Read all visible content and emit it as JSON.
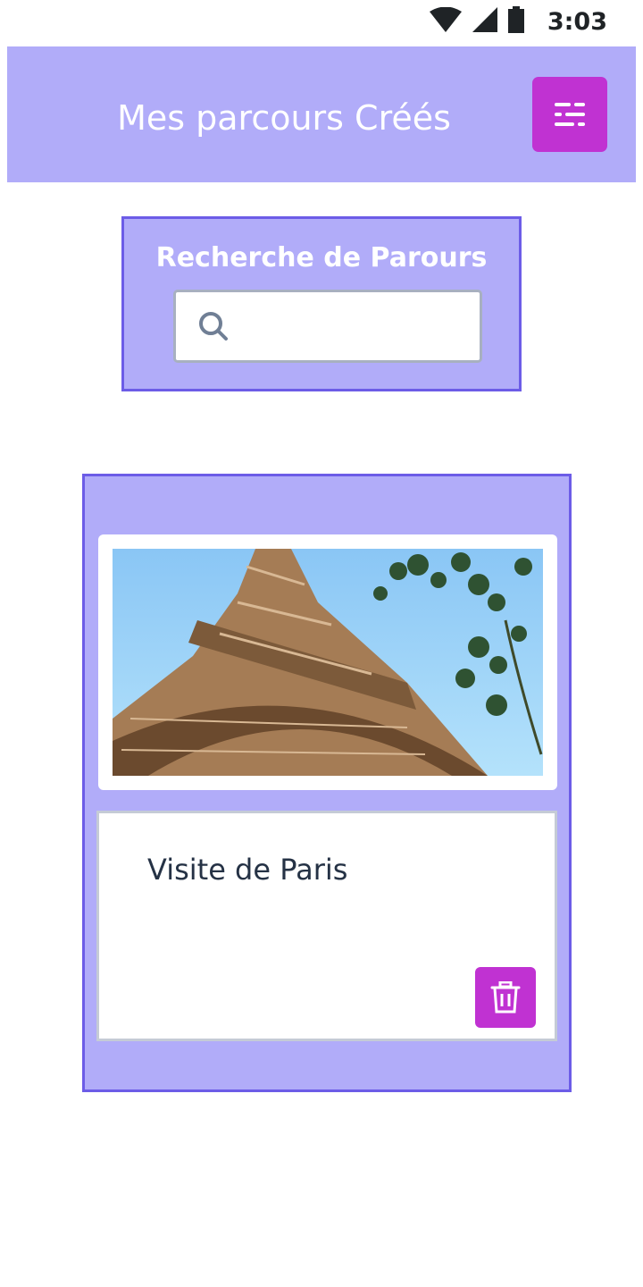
{
  "status_bar": {
    "time": "3:03",
    "icons": [
      "wifi-icon",
      "cell-signal-icon",
      "battery-icon"
    ]
  },
  "header": {
    "title": "Mes parcours Créés",
    "filter_icon": "filter-icon"
  },
  "search": {
    "title": "Recherche de Parours",
    "value": "",
    "icon": "search-icon"
  },
  "routes": [
    {
      "name": "Visite de Paris",
      "image": "eiffel-tower-photo",
      "delete_icon": "trash-icon"
    }
  ],
  "colors": {
    "panel_bg": "#b1acf9",
    "panel_border": "#6c5ce7",
    "accent": "#c032d2",
    "text_dark": "#253245"
  }
}
